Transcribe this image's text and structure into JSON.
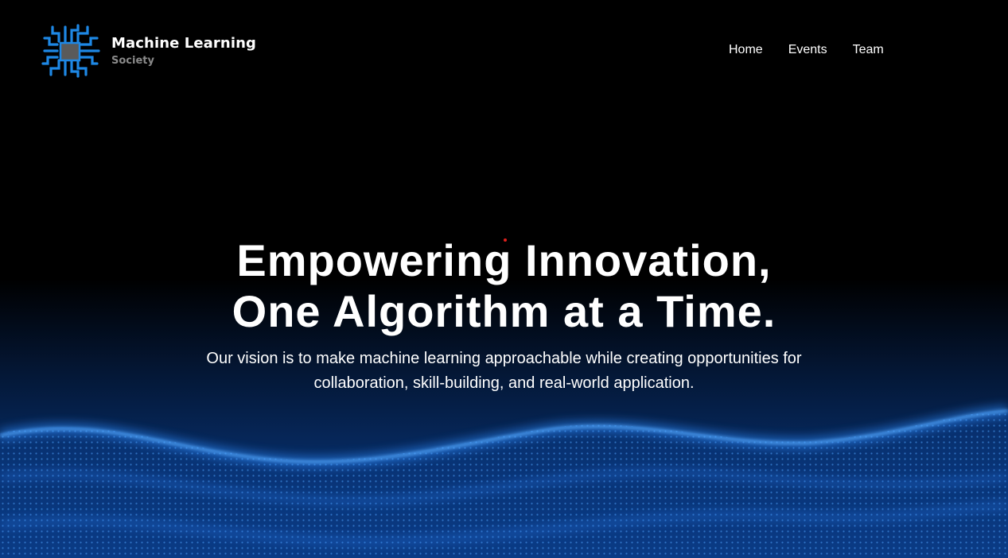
{
  "brand": {
    "name": "Machine Learning",
    "tagline": "Society",
    "logo_icon": "circuit-chip-icon",
    "logo_color": "#1e88e5"
  },
  "nav": {
    "items": [
      {
        "label": "Home"
      },
      {
        "label": "Events"
      },
      {
        "label": "Team"
      }
    ]
  },
  "hero": {
    "title_line1": "Empowering Innovation,",
    "title_line2": "One Algorithm at a Time.",
    "subtitle": "Our vision is to make machine learning approachable while creating opportunities for collaboration, skill-building, and real-world application.",
    "background": "blue-particle-wave",
    "accent_color": "#1a6cff"
  }
}
